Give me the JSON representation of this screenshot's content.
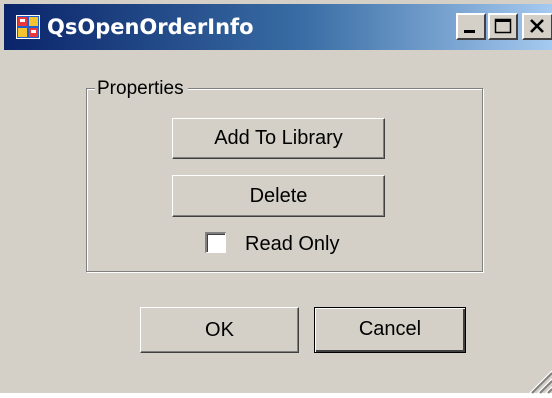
{
  "window": {
    "title": "QsOpenOrderInfo",
    "app_icon": "app-window-icon",
    "controls": {
      "minimize_icon": "minimize-icon",
      "maximize_icon": "maximize-icon",
      "close_icon": "close-icon"
    }
  },
  "properties_group": {
    "label": "Properties",
    "add_to_library_label": "Add To Library",
    "delete_label": "Delete",
    "read_only": {
      "label": "Read Only",
      "checked": false
    }
  },
  "footer": {
    "ok_label": "OK",
    "cancel_label": "Cancel"
  },
  "colors": {
    "face": "#d4d0c8",
    "title_start": "#0a246a",
    "title_end": "#a6caf0"
  },
  "resize_grip_icon": "resize-grip-icon"
}
